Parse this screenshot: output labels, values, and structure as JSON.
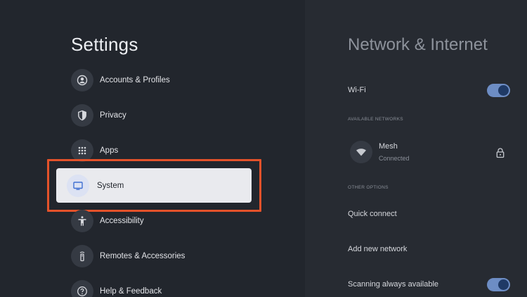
{
  "left": {
    "title": "Settings",
    "items": [
      {
        "label": "Accounts & Profiles",
        "icon": "account-circle-icon"
      },
      {
        "label": "Privacy",
        "icon": "shield-icon"
      },
      {
        "label": "Apps",
        "icon": "apps-grid-icon"
      },
      {
        "label": "System",
        "icon": "tv-icon",
        "selected": true
      },
      {
        "label": "Accessibility",
        "icon": "accessibility-icon"
      },
      {
        "label": "Remotes & Accessories",
        "icon": "remote-icon"
      },
      {
        "label": "Help & Feedback",
        "icon": "help-icon"
      }
    ]
  },
  "right": {
    "title": "Network & Internet",
    "wifi_label": "Wi-Fi",
    "wifi_on": true,
    "available_networks_header": "AVAILABLE NETWORKS",
    "network": {
      "name": "Mesh",
      "status": "Connected",
      "icon": "wifi-icon",
      "secured_icon": "lock-icon"
    },
    "other_options_header": "OTHER OPTIONS",
    "quick_connect": "Quick connect",
    "add_network": "Add new network",
    "scanning_label": "Scanning always available",
    "scanning_on": true
  },
  "colors": {
    "highlight": "#e4522a",
    "toggle_track": "#6d8dc4",
    "toggle_knob": "#1f3a66",
    "background": "#22262d"
  }
}
